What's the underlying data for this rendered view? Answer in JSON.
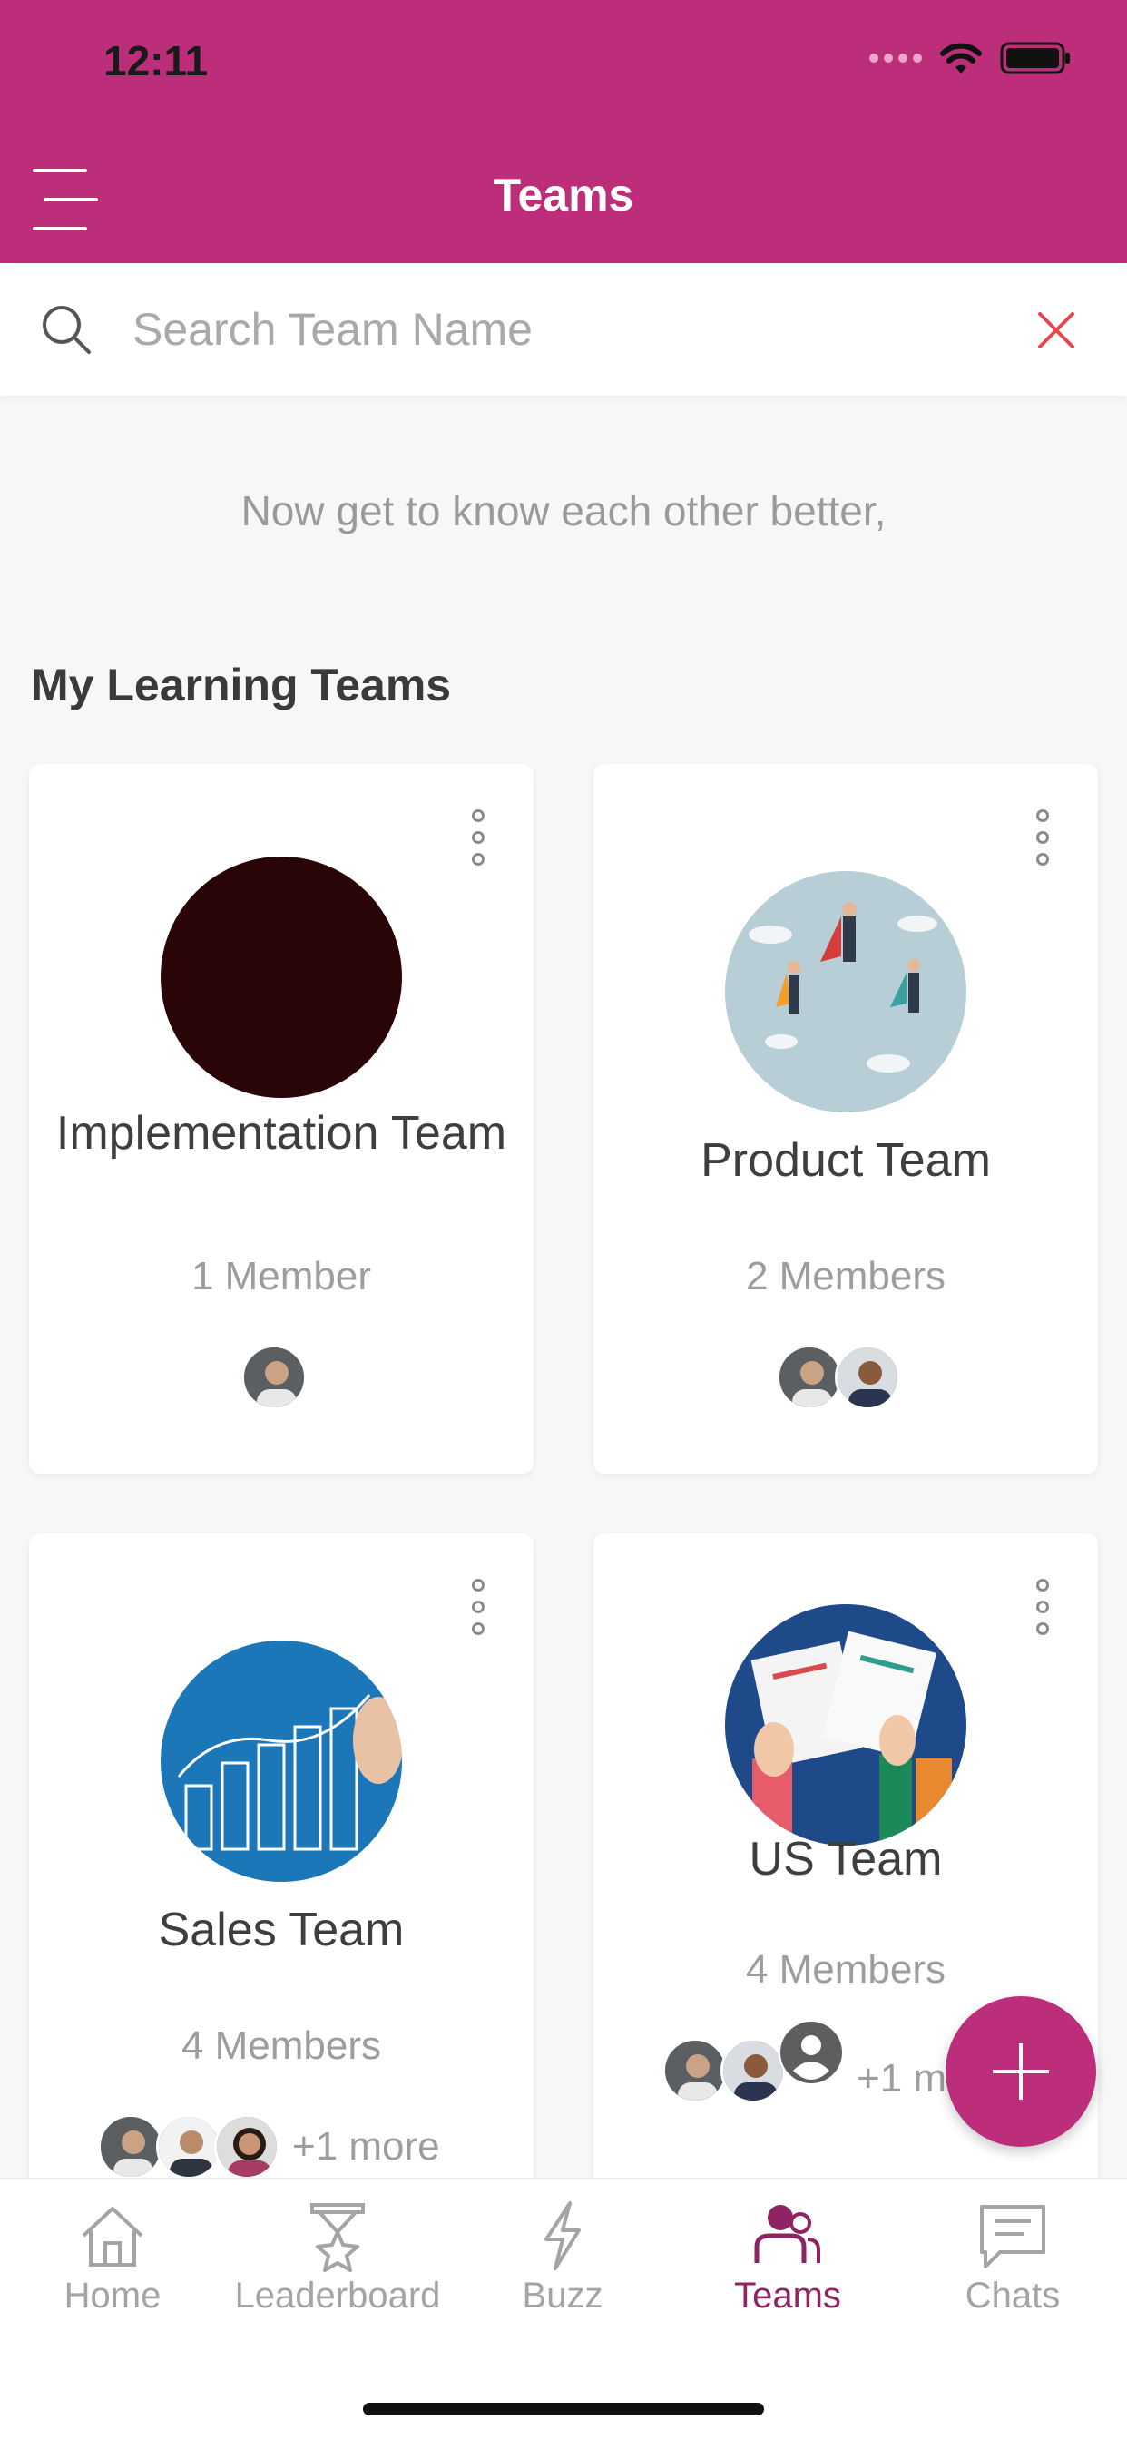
{
  "status": {
    "time": "12:11"
  },
  "header": {
    "title": "Teams"
  },
  "search": {
    "placeholder": "Search Team Name"
  },
  "tagline": "Now get to know each other better,",
  "section_title": "My Learning Teams",
  "teams": [
    {
      "name": "Implementation Team",
      "members": "1 Member"
    },
    {
      "name": "Product Team",
      "members": "2 Members"
    },
    {
      "name": "Sales Team",
      "members": "4 Members",
      "more": "+1 more"
    },
    {
      "name": "US Team",
      "members": "4 Members",
      "more": "+1 more"
    }
  ],
  "tabs": [
    {
      "label": "Home",
      "icon": "home-icon"
    },
    {
      "label": "Leaderboard",
      "icon": "leaderboard-icon"
    },
    {
      "label": "Buzz",
      "icon": "buzz-icon"
    },
    {
      "label": "Teams",
      "icon": "teams-icon",
      "active": true
    },
    {
      "label": "Chats",
      "icon": "chats-icon"
    }
  ],
  "colors": {
    "brand": "#bc2e79",
    "active_tab": "#8e2463"
  }
}
